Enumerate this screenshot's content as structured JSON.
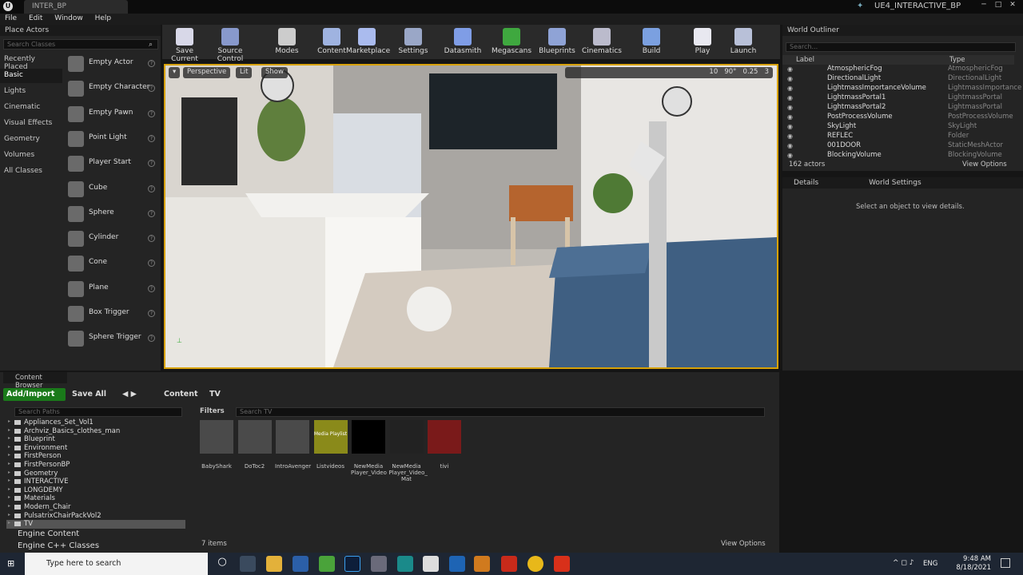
{
  "window": {
    "doc_tab": "INTER_BP",
    "project": "UE4_INTERACTIVE_BP"
  },
  "menu": [
    "File",
    "Edit",
    "Window",
    "Help"
  ],
  "place_actors": {
    "title": "Place Actors",
    "search_placeholder": "Search Classes",
    "categories": [
      "Recently Placed",
      "Basic",
      "Lights",
      "Cinematic",
      "Visual Effects",
      "Geometry",
      "Volumes",
      "All Classes"
    ],
    "selected_category": "Basic",
    "items": [
      "Empty Actor",
      "Empty Character",
      "Empty Pawn",
      "Point Light",
      "Player Start",
      "Cube",
      "Sphere",
      "Cylinder",
      "Cone",
      "Plane",
      "Box Trigger",
      "Sphere Trigger"
    ]
  },
  "toolbar": [
    {
      "label": "Save Current",
      "icon": "save-icon",
      "color": "#d8d8e8"
    },
    {
      "label": "Source Control",
      "icon": "source-control-icon",
      "color": "#8899cc"
    },
    {
      "label": "Modes",
      "icon": "modes-icon",
      "color": "#cccccc"
    },
    {
      "label": "Content",
      "icon": "content-icon",
      "color": "#9fb3e0"
    },
    {
      "label": "Marketplace",
      "icon": "marketplace-icon",
      "color": "#aabbee"
    },
    {
      "label": "Settings",
      "icon": "settings-icon",
      "color": "#9aa7c7"
    },
    {
      "label": "Datasmith",
      "icon": "datasmith-icon",
      "color": "#7f9de6"
    },
    {
      "label": "Megascans",
      "icon": "megascans-icon",
      "color": "#3fa83f"
    },
    {
      "label": "Blueprints",
      "icon": "blueprints-icon",
      "color": "#8fa3d6"
    },
    {
      "label": "Cinematics",
      "icon": "cinematics-icon",
      "color": "#bbbbcc"
    },
    {
      "label": "Build",
      "icon": "build-icon",
      "color": "#7ba0e0"
    },
    {
      "label": "Play",
      "icon": "play-icon",
      "color": "#e8e8f0"
    },
    {
      "label": "Launch",
      "icon": "launch-icon",
      "color": "#b8c0d8"
    }
  ],
  "viewport": {
    "perspective": "Perspective",
    "lit": "Lit",
    "show": "Show",
    "fov": "90°",
    "snap": "10",
    "scale": "0.25",
    "cam_speed": "3"
  },
  "outliner": {
    "title": "World Outliner",
    "search_placeholder": "Search...",
    "col_label": "Label",
    "col_type": "Type",
    "rows": [
      {
        "label": "AtmosphericFog",
        "type": "AtmosphericFog"
      },
      {
        "label": "DirectionalLight",
        "type": "DirectionalLight"
      },
      {
        "label": "LightmassImportanceVolume",
        "type": "LightmassImportance"
      },
      {
        "label": "LightmassPortal1",
        "type": "LightmassPortal"
      },
      {
        "label": "LightmassPortal2",
        "type": "LightmassPortal"
      },
      {
        "label": "PostProcessVolume",
        "type": "PostProcessVolume"
      },
      {
        "label": "SkyLight",
        "type": "SkyLight"
      },
      {
        "label": "REFLEC",
        "type": "Folder"
      },
      {
        "label": "001DOOR",
        "type": "StaticMeshActor"
      },
      {
        "label": "BlockingVolume",
        "type": "BlockingVolume"
      }
    ],
    "count": "162 actors",
    "view_options": "View Options"
  },
  "details": {
    "tab1": "Details",
    "tab2": "World Settings",
    "message": "Select an object to view details."
  },
  "content_browser": {
    "title": "Content Browser",
    "add_import": "Add/Import",
    "save_all": "Save All",
    "crumbs": [
      "Content",
      "TV"
    ],
    "search_paths": "Search Paths",
    "folders": [
      "Appliances_Set_Vol1",
      "Archviz_Basics_clothes_man",
      "Blueprint",
      "Environment",
      "FirstPerson",
      "FirstPersonBP",
      "Geometry",
      "INTERACTIVE",
      "LONGDEMY",
      "Materials",
      "Modern_Chair",
      "PulsatrixChairPackVol2",
      "TV"
    ],
    "engine_content": "Engine Content",
    "engine_cpp": "Engine C++ Classes",
    "filters": "Filters",
    "search_tv": "Search TV",
    "assets": [
      {
        "name": "BabyShark",
        "thumb": "#4a4a4a"
      },
      {
        "name": "DoToc2",
        "thumb": "#4a4a4a"
      },
      {
        "name": "IntroAvenger",
        "thumb": "#4a4a4a"
      },
      {
        "name": "Listvideos",
        "thumb": "#8a8a1a",
        "overlay": "Media Playlist"
      },
      {
        "name": "NewMedia Player_Video",
        "thumb": "#000000"
      },
      {
        "name": "NewMedia Player_Video_ Mat",
        "thumb": "#222222"
      },
      {
        "name": "tivi",
        "thumb": "#7a1a1a"
      }
    ],
    "items": "7 items",
    "view_options": "View Options"
  },
  "taskbar": {
    "search": "Type here to search",
    "time": "9:48 AM",
    "date": "8/18/2021",
    "lang": "ENG"
  }
}
